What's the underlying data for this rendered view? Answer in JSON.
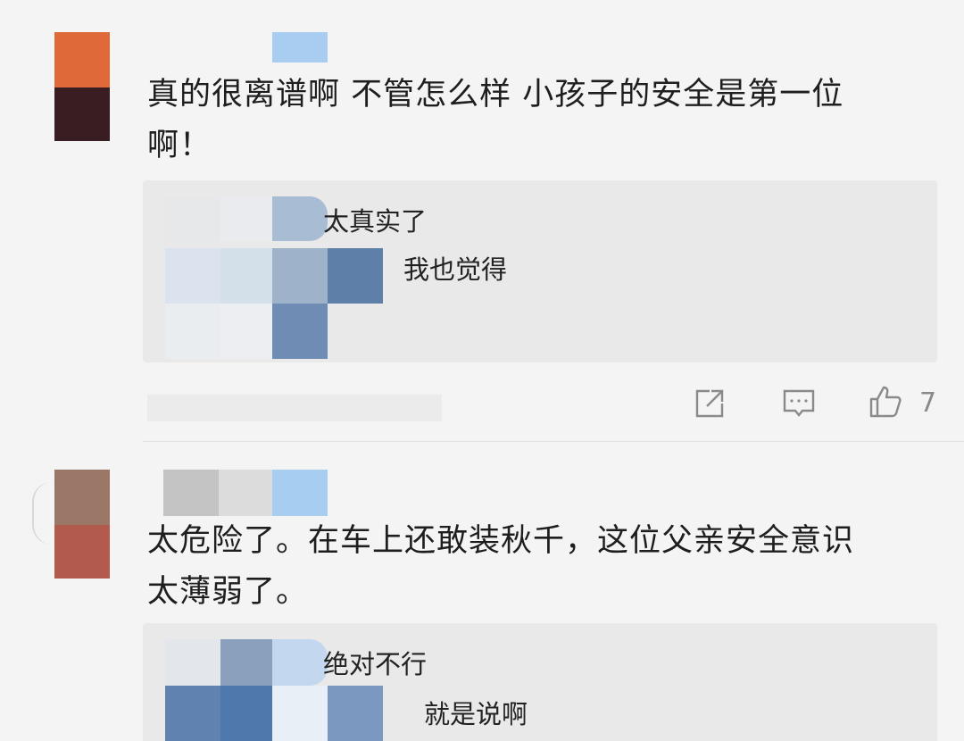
{
  "comment_1": {
    "text_line1": "真的很离谱啊 不管怎么样 小孩子的安全是第一位",
    "text_line2": "啊！",
    "replies": [
      {
        "text": "太真实了"
      },
      {
        "text": "我也觉得"
      }
    ],
    "actions": {
      "share_icon": "share-icon",
      "reply_icon": "comment-icon",
      "like_icon": "thumbs-up-icon",
      "like_count": "7"
    }
  },
  "comment_2": {
    "text_line1": "太危险了。在车上还敢装秋千，这位父亲安全意识",
    "text_line2": "太薄弱了。",
    "replies": [
      {
        "text": "绝对不行"
      },
      {
        "text": "就是说啊"
      }
    ]
  },
  "colors": {
    "background": "#f4f4f4",
    "reply_background": "#e9e9e9",
    "icon_gray": "#8a8a8a"
  }
}
